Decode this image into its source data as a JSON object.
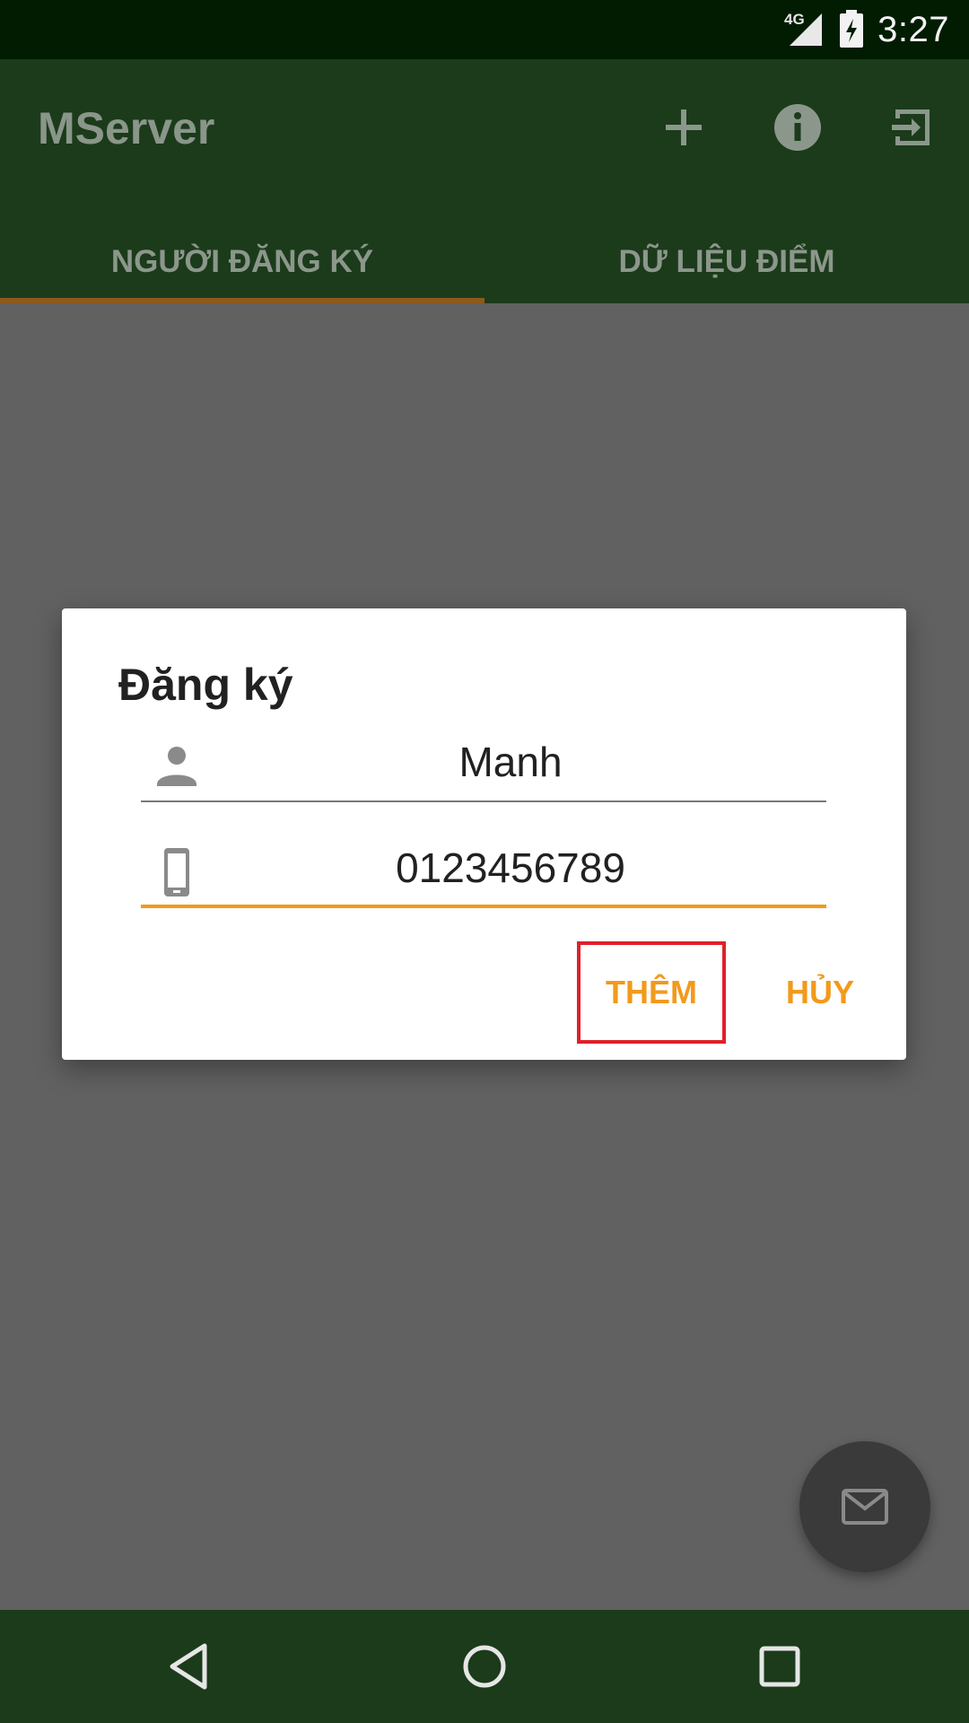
{
  "status_bar": {
    "network": "4G",
    "time": "3:27"
  },
  "app_bar": {
    "title": "MServer"
  },
  "icons": {
    "add": "plus-icon",
    "info": "info-icon",
    "exit": "exit-icon"
  },
  "tabs": [
    {
      "label": "NGƯỜI ĐĂNG KÝ",
      "selected": true
    },
    {
      "label": "DỮ LIỆU ĐIỂM",
      "selected": false
    }
  ],
  "dialog": {
    "title": "Đăng ký",
    "name_field": {
      "value": "Manh",
      "icon": "person-icon"
    },
    "phone_field": {
      "value": "0123456789",
      "icon": "phone-icon"
    },
    "add_button": "THÊM",
    "cancel_button": "HỦY"
  },
  "fab": {
    "icon": "mail-icon"
  },
  "colors": {
    "accent": "#f29a1c",
    "primary": "#1b3b1b",
    "highlight": "#e0202a"
  }
}
